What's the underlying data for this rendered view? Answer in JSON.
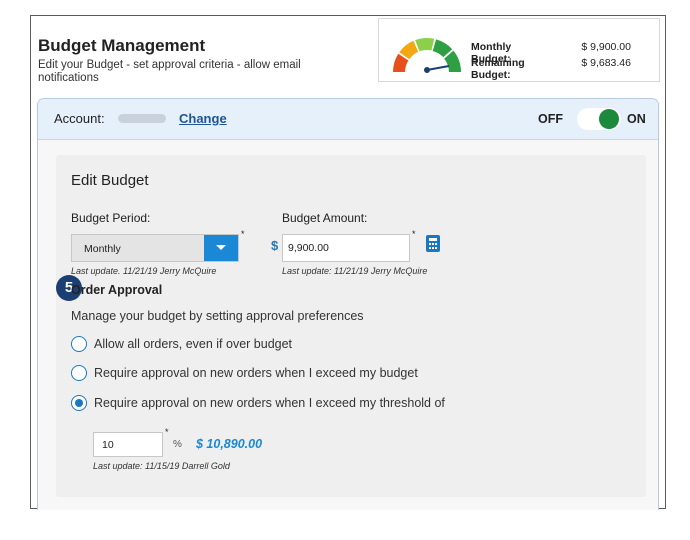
{
  "header": {
    "title": "Budget Management",
    "subtitle": "Edit your Budget - set approval criteria - allow email notifications"
  },
  "budget_summary": {
    "gauge_icon": "budget-gauge-icon",
    "gauge_level": 0.97,
    "monthly_label": "Monthly Budget:",
    "monthly_value": "$ 9,900.00",
    "remaining_label": "Remaining Budget:",
    "remaining_value": "$ 9,683.46"
  },
  "account": {
    "label": "Account:",
    "change_label": "Change",
    "toggle_off_label": "OFF",
    "toggle_on_label": "ON",
    "toggle_state": "on",
    "toggle_color": "#1c8a3c"
  },
  "edit_budget": {
    "title": "Edit Budget",
    "period_label": "Budget Period:",
    "period_value": "Monthly",
    "period_required": "*",
    "period_last_update": "Last update. 11/21/19 Jerry McQuire",
    "amount_label": "Budget Amount:",
    "currency_symbol": "$",
    "amount_value": "9,900.00",
    "amount_required": "*",
    "amount_last_update": "Last update: 11/21/19 Jerry McQuire",
    "calculator_icon": "calculator-icon"
  },
  "order_approval": {
    "step_number": "5",
    "title": "Order Approval",
    "description": "Manage your budget by setting approval preferences",
    "options": [
      {
        "label": "Allow all orders, even if over budget",
        "selected": false
      },
      {
        "label": "Require approval on new orders when I exceed my budget",
        "selected": false
      },
      {
        "label": "Require approval on new orders when I exceed my threshold of",
        "selected": true
      }
    ],
    "threshold_value": "10",
    "threshold_required": "*",
    "threshold_unit": "%",
    "threshold_amount": "$ 10,890.00",
    "threshold_last_update": "Last update: 11/15/19 Darrell Gold"
  },
  "colors": {
    "accent": "#1a78c2",
    "dropdown": "#1a88d4",
    "step_badge": "#1c3f73",
    "gauge_red": "#e8501b",
    "gauge_orange": "#f3a712",
    "gauge_yellow": "#f7cf1a",
    "gauge_lightgreen": "#8ccf4a",
    "gauge_green": "#2ea043"
  }
}
